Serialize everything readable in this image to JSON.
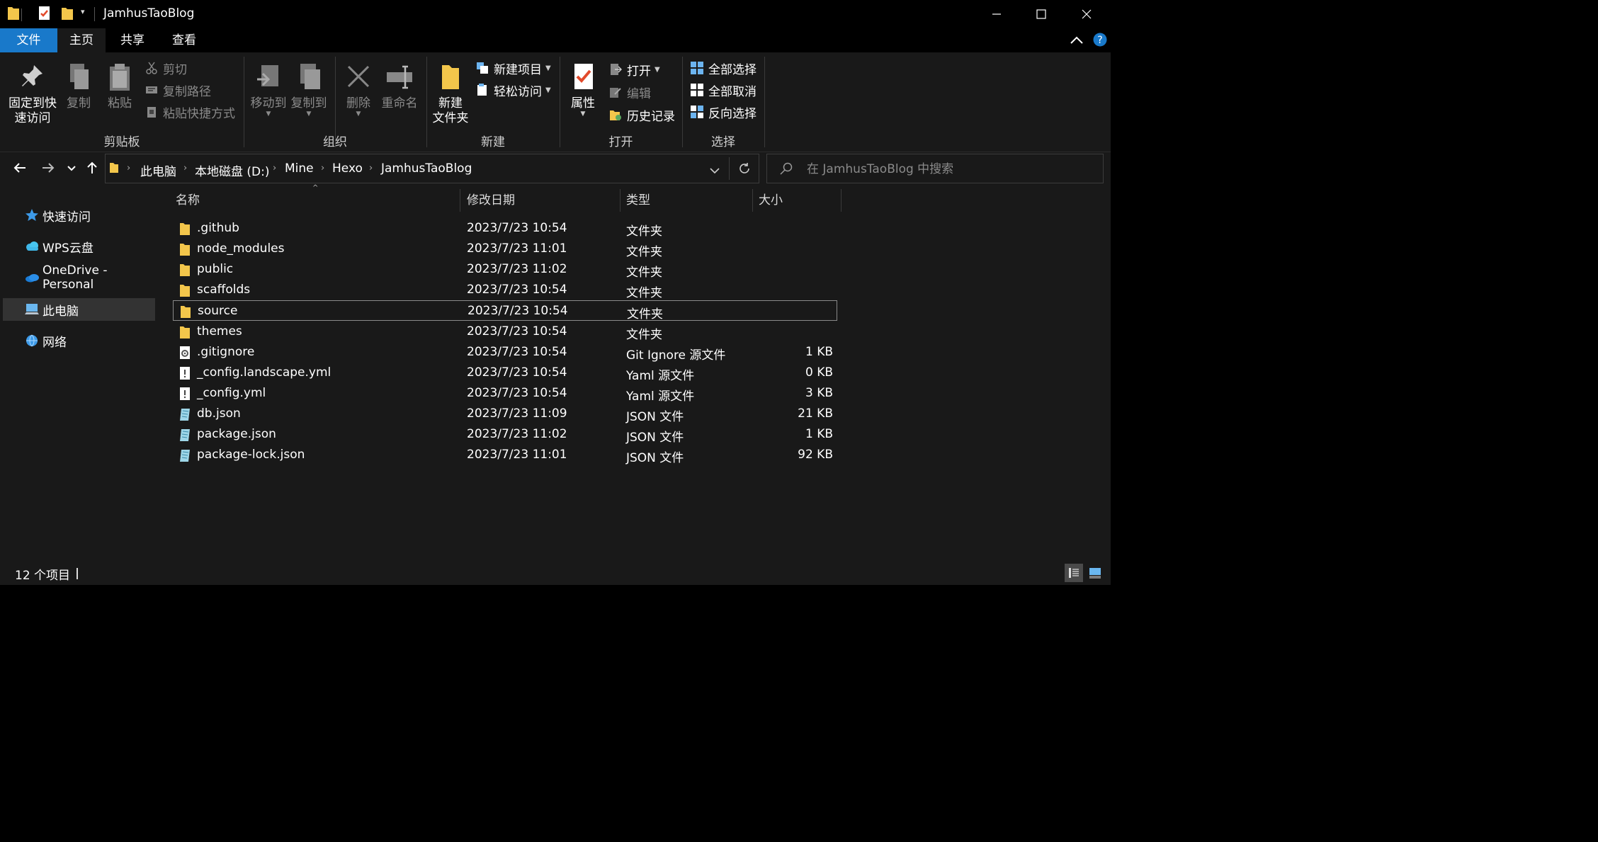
{
  "window": {
    "title": "JamhusTaoBlog",
    "controls": [
      "minimize-icon",
      "maximize-icon",
      "close-icon"
    ]
  },
  "tabs": [
    {
      "label": "文件"
    },
    {
      "label": "主页"
    },
    {
      "label": "共享"
    },
    {
      "label": "查看"
    }
  ],
  "ribbon": {
    "clipboard": {
      "group_label": "剪贴板",
      "pin_line1": "固定到快",
      "pin_line2": "速访问",
      "copy": "复制",
      "paste": "粘贴",
      "cut": "剪切",
      "copy_path": "复制路径",
      "paste_shortcut": "粘贴快捷方式"
    },
    "organize": {
      "group_label": "组织",
      "move_to": "移动到",
      "copy_to": "复制到",
      "delete": "删除",
      "rename": "重命名"
    },
    "new": {
      "group_label": "新建",
      "new_folder_line1": "新建",
      "new_folder_line2": "文件夹",
      "new_item": "新建项目",
      "easy_access": "轻松访问"
    },
    "open": {
      "group_label": "打开",
      "properties": "属性",
      "open": "打开",
      "edit": "编辑",
      "history": "历史记录"
    },
    "select": {
      "group_label": "选择",
      "select_all": "全部选择",
      "select_none": "全部取消",
      "invert": "反向选择"
    }
  },
  "address": {
    "crumbs": [
      "此电脑",
      "本地磁盘 (D:)",
      "Mine",
      "Hexo",
      "JamhusTaoBlog"
    ]
  },
  "search": {
    "placeholder": "在 JamhusTaoBlog 中搜索"
  },
  "nav_pane": [
    {
      "label": "快速访问",
      "icon": "star-icon"
    },
    {
      "label": "WPS云盘",
      "icon": "cloud-icon"
    },
    {
      "label": "OneDrive - Personal",
      "icon": "onedrive-icon"
    },
    {
      "label": "此电脑",
      "icon": "computer-icon"
    },
    {
      "label": "网络",
      "icon": "network-icon"
    }
  ],
  "columns": [
    "名称",
    "修改日期",
    "类型",
    "大小"
  ],
  "files": [
    {
      "name": ".github",
      "date": "2023/7/23 10:54",
      "type": "文件夹",
      "size": "",
      "icon": "folder-icon"
    },
    {
      "name": "node_modules",
      "date": "2023/7/23 11:01",
      "type": "文件夹",
      "size": "",
      "icon": "folder-icon"
    },
    {
      "name": "public",
      "date": "2023/7/23 11:02",
      "type": "文件夹",
      "size": "",
      "icon": "folder-icon"
    },
    {
      "name": "scaffolds",
      "date": "2023/7/23 10:54",
      "type": "文件夹",
      "size": "",
      "icon": "folder-icon"
    },
    {
      "name": "source",
      "date": "2023/7/23 10:54",
      "type": "文件夹",
      "size": "",
      "icon": "folder-icon"
    },
    {
      "name": "themes",
      "date": "2023/7/23 10:54",
      "type": "文件夹",
      "size": "",
      "icon": "folder-icon"
    },
    {
      "name": ".gitignore",
      "date": "2023/7/23 10:54",
      "type": "Git Ignore 源文件",
      "size": "1 KB",
      "icon": "gear-file-icon"
    },
    {
      "name": "_config.landscape.yml",
      "date": "2023/7/23 10:54",
      "type": "Yaml 源文件",
      "size": "0 KB",
      "icon": "yaml-file-icon"
    },
    {
      "name": "_config.yml",
      "date": "2023/7/23 10:54",
      "type": "Yaml 源文件",
      "size": "3 KB",
      "icon": "yaml-file-icon"
    },
    {
      "name": "db.json",
      "date": "2023/7/23 11:09",
      "type": "JSON 文件",
      "size": "21 KB",
      "icon": "json-file-icon"
    },
    {
      "name": "package.json",
      "date": "2023/7/23 11:02",
      "type": "JSON 文件",
      "size": "1 KB",
      "icon": "json-file-icon"
    },
    {
      "name": "package-lock.json",
      "date": "2023/7/23 11:01",
      "type": "JSON 文件",
      "size": "92 KB",
      "icon": "json-file-icon"
    }
  ],
  "status": {
    "count": "12 个项目"
  },
  "colors": {
    "accent": "#1979ca",
    "folder": "#f3c64b",
    "background": "#191919"
  }
}
